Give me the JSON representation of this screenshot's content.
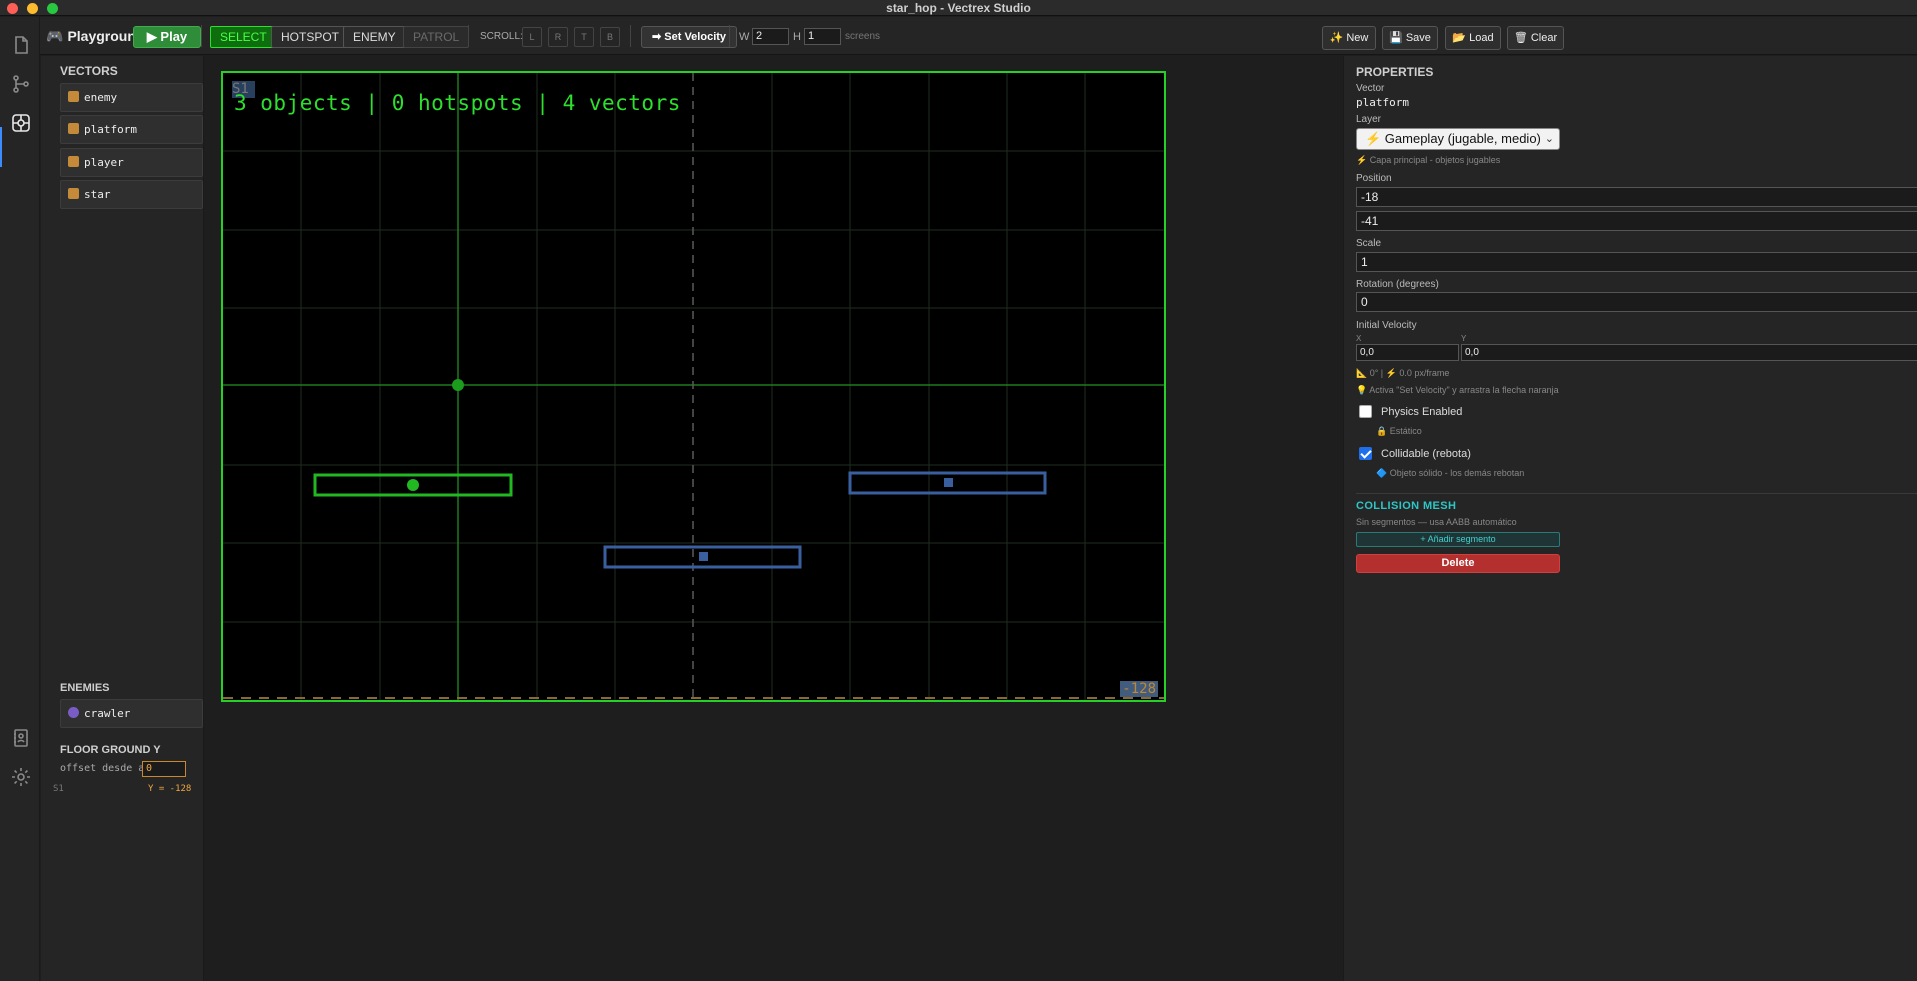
{
  "window": {
    "title": "star_hop - Vectrex Studio"
  },
  "toolbar": {
    "app_name": "Playground",
    "play_label": "▶ Play",
    "modes": [
      "SELECT",
      "HOTSPOT",
      "ENEMY",
      "PATROL"
    ],
    "active_mode": "SELECT",
    "scroll_label": "SCROLL:",
    "scroll_buttons": [
      "L",
      "R",
      "T",
      "B"
    ],
    "velocity_label": "➡ Set Velocity",
    "w_label": "W",
    "w_value": "2",
    "h_label": "H",
    "h_value": "1",
    "screens_label": "screens",
    "new_label": "✨ New",
    "save_label": "💾 Save",
    "load_label": "📂 Load",
    "clear_label": "🗑 Clear"
  },
  "sidebar": {
    "vectors_title": "VECTORS",
    "vectors": [
      "enemy",
      "platform",
      "player",
      "star"
    ],
    "enemies_title": "ENEMIES",
    "enemies": [
      "crawler"
    ],
    "floor_title": "FLOOR GROUND Y",
    "floor_offset_label": "offset desde abajo",
    "floor_offset_value": "0",
    "floor_screen": "S1",
    "floor_y_text": "Y = -128"
  },
  "canvas": {
    "hud_text": "3 objects | 0 hotspots | 4 vectors",
    "screen_tag": "S1",
    "floor_tag": "-128"
  },
  "properties": {
    "title": "PROPERTIES",
    "vector_label": "Vector",
    "vector_value": "platform",
    "layer_label": "Layer",
    "layer_value": "⚡ Gameplay (jugable, medio)",
    "layer_hint": "⚡ Capa principal - objetos jugables",
    "position_label": "Position",
    "position_x": "-18",
    "position_y": "-41",
    "scale_label": "Scale",
    "scale_value": "1",
    "rotation_label": "Rotation (degrees)",
    "rotation_value": "0",
    "velocity_label": "Initial Velocity",
    "velocity_x_label": "X",
    "velocity_x": "0,0",
    "velocity_y_label": "Y",
    "velocity_y": "0,0",
    "velocity_info": "📐 0° | ⚡ 0.0 px/frame",
    "velocity_hint": "💡 Activa \"Set Velocity\" y arrastra la flecha naranja",
    "physics_label": "Physics Enabled",
    "physics_enabled": false,
    "static_hint": "🔒 Estático",
    "collidable_label": "Collidable (rebota)",
    "collidable_enabled": true,
    "collidable_hint": "🔷 Objeto sólido - los demás rebotan",
    "mesh_title": "COLLISION MESH",
    "mesh_hint": "Sin segmentos — usa AABB automático",
    "add_segment_label": "+ Añadir segmento",
    "delete_label": "Delete"
  },
  "colors": {
    "accent_green": "#2de02d",
    "selected_object": "#22b822",
    "platform_blue": "#3a5f9e",
    "floor_orange": "#e0a040",
    "delete_red": "#b3302f",
    "mesh_cyan": "#2ec6c6"
  }
}
